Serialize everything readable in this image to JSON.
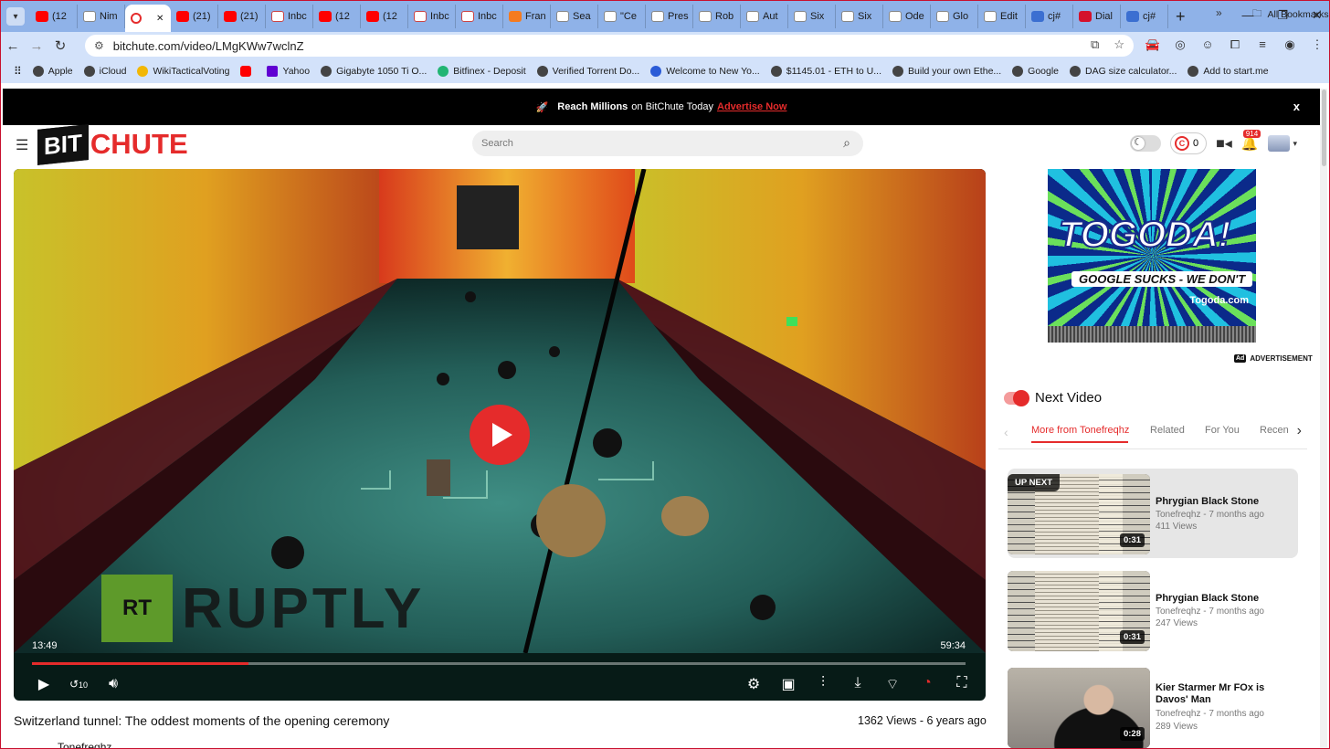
{
  "browser": {
    "tabs": [
      {
        "icon": "yt",
        "label": "(12"
      },
      {
        "icon": "doc",
        "label": "Nim"
      },
      {
        "icon": "bc",
        "label": "",
        "active": true
      },
      {
        "icon": "yt",
        "label": "(21)"
      },
      {
        "icon": "yt",
        "label": "(21)"
      },
      {
        "icon": "gm",
        "label": "Inbc"
      },
      {
        "icon": "yt",
        "label": "(12"
      },
      {
        "icon": "yt",
        "label": "(12"
      },
      {
        "icon": "gm",
        "label": "Inbc"
      },
      {
        "icon": "gm",
        "label": "Inbc"
      },
      {
        "icon": "org",
        "label": "Fran"
      },
      {
        "icon": "doc",
        "label": "Sea"
      },
      {
        "icon": "doc",
        "label": "\"Ce"
      },
      {
        "icon": "doc",
        "label": "Pres"
      },
      {
        "icon": "doc",
        "label": "Rob"
      },
      {
        "icon": "doc",
        "label": "Aut"
      },
      {
        "icon": "doc",
        "label": "Six"
      },
      {
        "icon": "doc",
        "label": "Six"
      },
      {
        "icon": "doc",
        "label": "Ode"
      },
      {
        "icon": "doc",
        "label": "Glo"
      },
      {
        "icon": "doc",
        "label": "Edit"
      },
      {
        "icon": "blue",
        "label": "cj#"
      },
      {
        "icon": "red",
        "label": "Dial"
      },
      {
        "icon": "blue",
        "label": "cj#"
      }
    ],
    "url": "bitchute.com/video/LMgKWw7wclnZ",
    "bookmarks": [
      {
        "icon": "apple",
        "label": "Apple"
      },
      {
        "icon": "icloud",
        "label": "iCloud"
      },
      {
        "icon": "gy",
        "label": "WikiTacticalVoting"
      },
      {
        "icon": "yt",
        "label": ""
      },
      {
        "icon": "ya",
        "label": "Yahoo"
      },
      {
        "icon": "gig",
        "label": "Gigabyte 1050 Ti O..."
      },
      {
        "icon": "gr",
        "label": "Bitfinex - Deposit"
      },
      {
        "icon": "vt",
        "label": "Verified Torrent Do..."
      },
      {
        "icon": "blu",
        "label": "Welcome to New Yo..."
      },
      {
        "icon": "eth",
        "label": "$1145.01 - ETH to U..."
      },
      {
        "icon": "build",
        "label": "Build your own Ethe..."
      },
      {
        "icon": "google",
        "label": "Google"
      },
      {
        "icon": "dag",
        "label": "DAG size calculator..."
      },
      {
        "icon": "start",
        "label": "Add to start.me"
      }
    ],
    "all_bookmarks": "All Bookmarks"
  },
  "promo": {
    "lead": "Reach Millions",
    "middle": "on BitChute Today",
    "link": "Advertise Now",
    "close": "x"
  },
  "header": {
    "logo_left": "BIT",
    "logo_right": "CHUTE",
    "search_placeholder": "Search",
    "coins": "0",
    "notifications": "914"
  },
  "player": {
    "current_time": "13:49",
    "duration": "59:34",
    "progress": 0.232,
    "watermark_box": "RT",
    "watermark_text": "RUPTLY",
    "skip_label": "10"
  },
  "video": {
    "title": "Switzerland tunnel: The oddest moments of the opening ceremony",
    "meta": "1362 Views - 6 years ago",
    "channel": "Tonefreqhz"
  },
  "ad": {
    "title": "TOGODA!",
    "subtitle": "GOOGLE SUCKS - WE DON'T",
    "domain": "Togoda.com",
    "label": "ADVERTISEMENT"
  },
  "sidebar": {
    "next_label": "Next Video",
    "tabs": [
      "More from Tonefreqhz",
      "Related",
      "For You",
      "Recen"
    ],
    "up_next": "UP NEXT",
    "cards": [
      {
        "title": "Phrygian Black Stone",
        "channel_age": "Tonefreqhz - 7 months ago",
        "views": "411 Views",
        "duration": "0:31"
      },
      {
        "title": "Phrygian Black Stone",
        "channel_age": "Tonefreqhz - 7 months ago",
        "views": "247 Views",
        "duration": "0:31"
      },
      {
        "title": "Kier Starmer Mr FOx is Davos' Man",
        "channel_age": "Tonefreqhz - 7 months ago",
        "views": "289 Views",
        "duration": "0:28"
      }
    ]
  },
  "colors": {
    "brand_red": "#e52b2b",
    "promo_bg": "#000000"
  }
}
